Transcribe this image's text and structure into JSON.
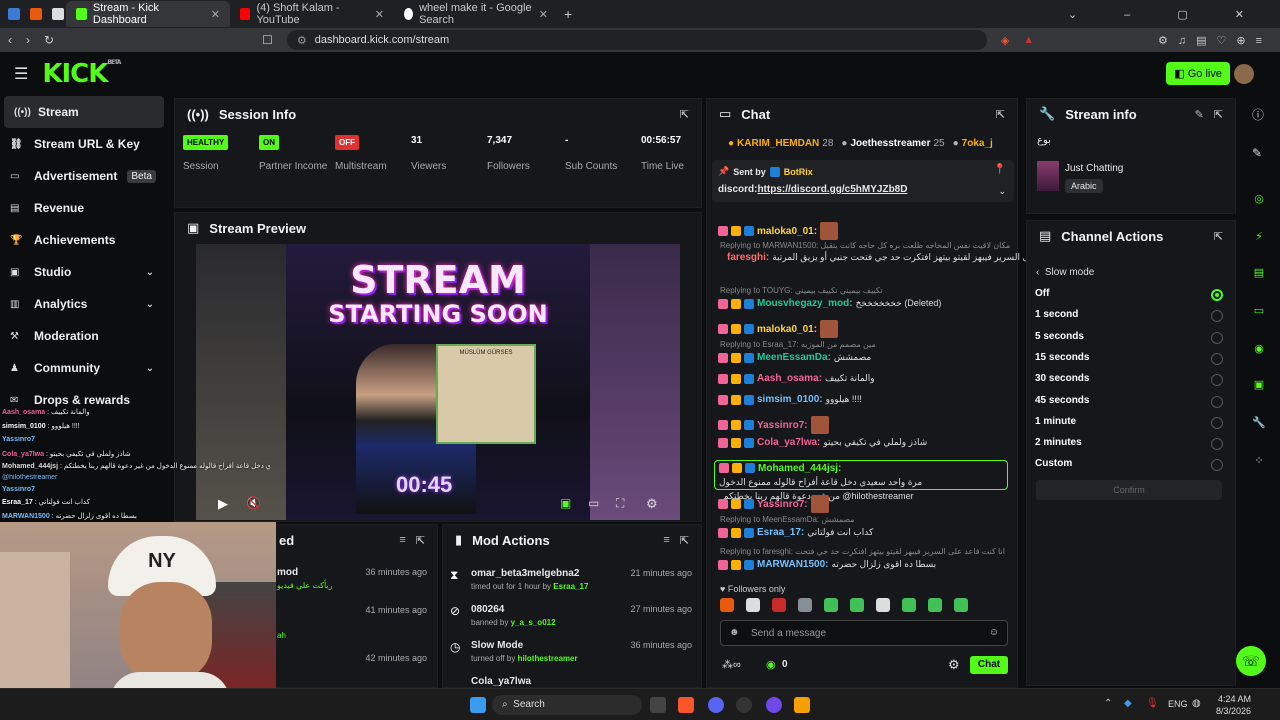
{
  "browser": {
    "tabs": [
      {
        "label": "Stream - Kick Dashboard",
        "active": true
      },
      {
        "label": "(4) Shoft Kalam - YouTube",
        "active": false
      },
      {
        "label": "wheel make it - Google Search",
        "active": false
      }
    ],
    "url": "dashboard.kick.com/stream"
  },
  "header": {
    "logo": "KICK",
    "logo_sup": "BETA",
    "go_live": "Go live"
  },
  "sidebar": {
    "items": [
      {
        "label": "Stream",
        "icon": "broadcast-icon"
      },
      {
        "label": "Stream URL & Key",
        "icon": "link-icon"
      },
      {
        "label": "Advertisement",
        "badge": "Beta",
        "icon": "monitor-icon"
      },
      {
        "label": "Revenue",
        "icon": "wallet-icon"
      },
      {
        "label": "Achievements",
        "icon": "trophy-icon"
      },
      {
        "label": "Studio",
        "icon": "film-icon"
      },
      {
        "label": "Analytics",
        "icon": "chart-icon"
      },
      {
        "label": "Moderation",
        "icon": "hammer-icon"
      },
      {
        "label": "Community",
        "icon": "people-icon"
      },
      {
        "label": "Drops & rewards",
        "icon": "gift-icon"
      }
    ]
  },
  "overlay_chat": [
    {
      "user": "Aash_osama",
      "text": "والمانة تكييف"
    },
    {
      "user": "simsim_0100",
      "text": "هيلووو !!!!"
    },
    {
      "user": "Yassinro7",
      "text": ""
    },
    {
      "user": "Cola_ya7lwa",
      "text": "شاذز ولملي في تكيفي بحيتو"
    },
    {
      "user": "Mohamed_444jsj",
      "text": "مرة واحد سعيدي دخل قاعة أفراح قالوله ممنوع الدخول من غير دعوة قالهم ربنا يخطتكم"
    },
    {
      "user": "",
      "text": "@hilothestreamer"
    },
    {
      "user": "Yassinro7",
      "text": ""
    },
    {
      "user": "Esraa_17",
      "text": "كداب انت فولتاتي"
    },
    {
      "user": "MARWAN1500",
      "text": "بسطا ده اقوى زلزال حضرته"
    }
  ],
  "session": {
    "title": "Session Info",
    "stats": [
      {
        "value": "HEALTHY",
        "label": "Session",
        "kind": "pill",
        "color": "#53fc18"
      },
      {
        "value": "ON",
        "label": "Partner Income",
        "kind": "pill",
        "color": "#53fc18"
      },
      {
        "value": "OFF",
        "label": "Multistream",
        "kind": "pill",
        "color": "#e03131"
      },
      {
        "value": "31",
        "label": "Viewers"
      },
      {
        "value": "7,347",
        "label": "Followers"
      },
      {
        "value": "-",
        "label": "Sub Counts"
      },
      {
        "value": "00:56:57",
        "label": "Time Live"
      }
    ]
  },
  "preview": {
    "title": "Stream Preview",
    "line1": "STREAM",
    "line2": "STARTING SOON",
    "timer": "00:45",
    "sign": "MÜSLÜM GÜRSES"
  },
  "events": {
    "title_suffix": "ed",
    "rows": [
      {
        "user": "mod",
        "sub": "ريأكت علي فيديو",
        "time": "36 minutes ago"
      },
      {
        "user": "",
        "sub": "",
        "time": "41 minutes ago"
      },
      {
        "user": "",
        "sub": "ah",
        "time": ""
      },
      {
        "user": "",
        "sub": "",
        "time": "42 minutes ago"
      }
    ]
  },
  "mod_actions": {
    "title": "Mod Actions",
    "rows": [
      {
        "icon": "hourglass-icon",
        "title": "omar_beta3melgebna2",
        "prefix": "timed out for 1 hour by",
        "by": "Esraa_17",
        "time": "21 minutes ago"
      },
      {
        "icon": "ban-icon",
        "title": "080264",
        "prefix": "banned by",
        "by": "y_a_s_o012",
        "time": "27 minutes ago"
      },
      {
        "icon": "clock-icon",
        "title": "Slow Mode",
        "prefix": "turned off by",
        "by": "hilothestreamer",
        "time": "36 minutes ago"
      },
      {
        "icon": "",
        "title": "Cola_ya7lwa",
        "prefix": "",
        "by": "",
        "time": ""
      }
    ]
  },
  "chat": {
    "title": "Chat",
    "gifters": [
      {
        "name": "KARIM_HEMDAN",
        "count": "28"
      },
      {
        "name": "Joethesstreamer",
        "count": "25"
      },
      {
        "name": "7oka_j",
        "count": ""
      }
    ],
    "pinned": {
      "sent_by": "Sent by",
      "bot": "BotRix",
      "text": "discord:",
      "link": "https://discord.gg/c5hMYJZb8D"
    },
    "messages": [
      {
        "type": "msg",
        "user": "maloka0_01:",
        "color": "#ffd43b",
        "text": ""
      },
      {
        "type": "reply",
        "text": "Replying to MARWAN1500: بزرت مكان لاقيت نفس المحاجه طلعت بره كل حاجه كانت بتقيل"
      },
      {
        "type": "msg",
        "user": "faresghi:",
        "color": "#ff6b6b",
        "text": "انا كنت قاعد على السرير فيبهز لقيتو بيتهز افتكرت حد جي فتحت جنبي أو يزيق المرتبة"
      },
      {
        "type": "reply",
        "text": "Replying to TOUYG: تكييف بيميني تكييف بيميني"
      },
      {
        "type": "msg",
        "user": "Mousvhegazy_mod:",
        "color": "#20c997",
        "text": "خخخخخخخخ (Deleted)"
      },
      {
        "type": "msg",
        "user": "maloka0_01:",
        "color": "#ffd43b",
        "text": ""
      },
      {
        "type": "reply",
        "text": "Replying to Esraa_17: مين مصمم من الموزيه"
      },
      {
        "type": "msg",
        "user": "MeenEssamDa:",
        "color": "#20c997",
        "text": "مصمشش"
      },
      {
        "type": "msg",
        "user": "Aash_osama:",
        "color": "#f06595",
        "text": "والمانة تكييف"
      },
      {
        "type": "msg",
        "user": "simsim_0100:",
        "color": "#74c0fc",
        "text": "هيلووو !!!!"
      },
      {
        "type": "msg",
        "user": "Yassinro7:",
        "color": "#f06595",
        "text": ""
      },
      {
        "type": "msg",
        "user": "Cola_ya7lwa:",
        "color": "#f06595",
        "text": "شاذز ولملي في تكيفي بحيتو"
      },
      {
        "type": "msg",
        "user": "Mohamed_444jsj:",
        "color": "#53fc18",
        "text": "مرة واحد سعيدي دخل قاعة أفراح قالوله ممنوع الدخول",
        "text2": "من غير دعوة قالهم ربنا يخطتكم @hilothestreamer"
      },
      {
        "type": "msg",
        "user": "Yassinro7:",
        "color": "#f06595",
        "text": ""
      },
      {
        "type": "reply",
        "text": "Replying to MeenEssamDa: مصمشش"
      },
      {
        "type": "msg",
        "user": "Esraa_17:",
        "color": "#74c0fc",
        "text": "كداب انت فولتاتي"
      },
      {
        "type": "reply",
        "text": "Replying to faresghi: انا كنت قاعد على السرير فيبهز لقيتو بيتهز افتكرت حد جي فتحت"
      },
      {
        "type": "msg",
        "user": "MARWAN1500:",
        "color": "#74c0fc",
        "text": "بسطا ده اقوى زلزال حضرته"
      }
    ],
    "followers_only": "Followers only",
    "placeholder": "Send a message",
    "count": "0",
    "send": "Chat"
  },
  "stream_info": {
    "title": "Stream info",
    "stream_title": "بوع",
    "category": "Just Chatting",
    "language": "Arabic"
  },
  "channel_actions": {
    "title": "Channel Actions",
    "back": "Slow mode",
    "confirm": "Confirm",
    "options": [
      "Off",
      "1 second",
      "5 seconds",
      "15 seconds",
      "30 seconds",
      "45 seconds",
      "1 minute",
      "2 minutes",
      "Custom"
    ],
    "selected": 0
  },
  "taskbar": {
    "search": "Search",
    "lang": "ENG",
    "time": "4:24 AM",
    "date": "8/3/2026"
  }
}
